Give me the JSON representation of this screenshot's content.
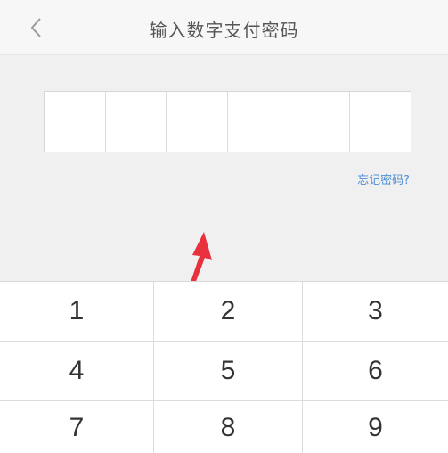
{
  "header": {
    "title": "输入数字支付密码",
    "back_icon": "chevron-left-icon"
  },
  "password": {
    "digits": 6,
    "forgot_label": "忘记密码?"
  },
  "keypad": {
    "keys": [
      "1",
      "2",
      "3",
      "4",
      "5",
      "6",
      "7",
      "8",
      "9"
    ]
  },
  "annotation": {
    "arrow_color": "#e8313c"
  },
  "colors": {
    "accent": "#4f8fd6",
    "background": "#efeff4"
  }
}
